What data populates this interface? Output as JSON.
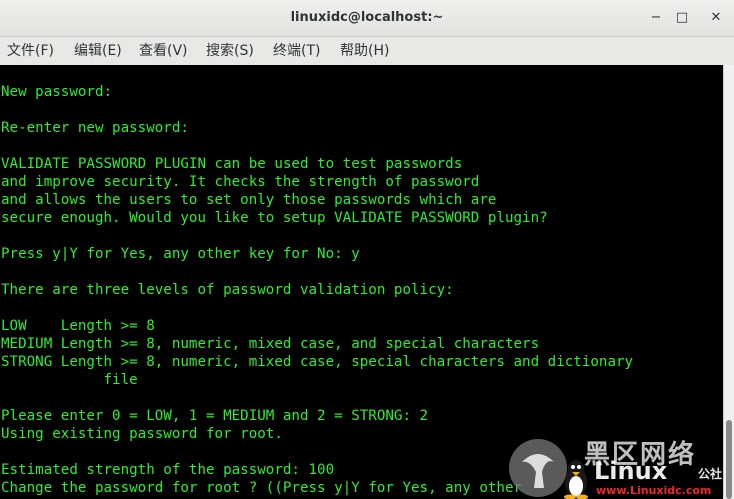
{
  "window": {
    "title": "linuxidc@localhost:~",
    "controls": {
      "minimize": "−",
      "maximize": "□",
      "close": "✕"
    }
  },
  "menu": {
    "items": [
      {
        "label": "文件(F)"
      },
      {
        "label": "编辑(E)"
      },
      {
        "label": "查看(V)"
      },
      {
        "label": "搜索(S)"
      },
      {
        "label": "终端(T)"
      },
      {
        "label": "帮助(H)"
      }
    ]
  },
  "terminal": {
    "text_color": "#2cee2c",
    "background": "#000000",
    "lines": [
      "New password:",
      "",
      "Re-enter new password:",
      "",
      "VALIDATE PASSWORD PLUGIN can be used to test passwords",
      "and improve security. It checks the strength of password",
      "and allows the users to set only those passwords which are",
      "secure enough. Would you like to setup VALIDATE PASSWORD plugin?",
      "",
      "Press y|Y for Yes, any other key for No: y",
      "",
      "There are three levels of password validation policy:",
      "",
      "LOW    Length >= 8",
      "MEDIUM Length >= 8, numeric, mixed case, and special characters",
      "STRONG Length >= 8, numeric, mixed case, special characters and dictionary",
      "            file",
      "",
      "Please enter 0 = LOW, 1 = MEDIUM and 2 = STRONG: 2",
      "Using existing password for root.",
      "",
      "Estimated strength of the password: 100",
      "Change the password for root ? ((Press y|Y for Yes, any other"
    ]
  },
  "watermark": {
    "site_name": "Linux公社",
    "brand": "Linux",
    "brand_suffix": "公社",
    "top_text": "黑区网络",
    "url": "www.Linuxidc.com"
  }
}
